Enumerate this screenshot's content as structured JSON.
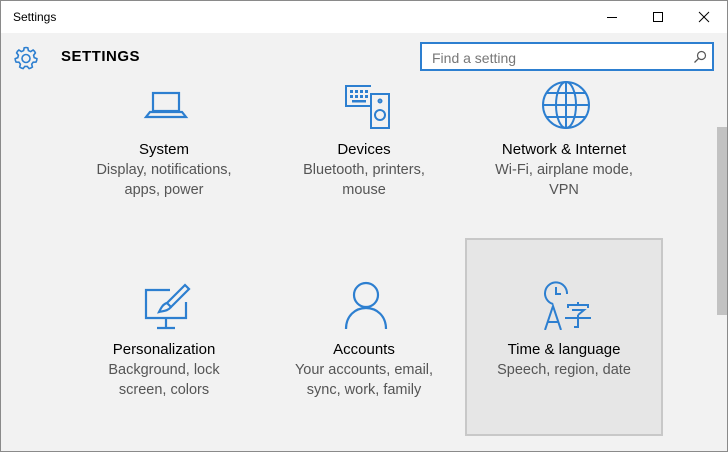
{
  "window": {
    "title": "Settings",
    "controls": {
      "minimize": "minimize",
      "maximize": "maximize",
      "close": "close"
    }
  },
  "header": {
    "title": "SETTINGS",
    "icon": "gear-icon"
  },
  "search": {
    "placeholder": "Find a setting",
    "value": "",
    "icon": "search-icon"
  },
  "accent_color": "#2d7fd0",
  "tiles": [
    {
      "label": "System",
      "desc1": "Display, notifications,",
      "desc2": "apps, power",
      "icon": "laptop-icon",
      "selected": false
    },
    {
      "label": "Devices",
      "desc1": "Bluetooth, printers,",
      "desc2": "mouse",
      "icon": "devices-icon",
      "selected": false
    },
    {
      "label": "Network & Internet",
      "desc1": "Wi-Fi, airplane mode,",
      "desc2": "VPN",
      "icon": "globe-icon",
      "selected": false
    },
    {
      "label": "Personalization",
      "desc1": "Background, lock",
      "desc2": "screen, colors",
      "icon": "personalization-icon",
      "selected": false
    },
    {
      "label": "Accounts",
      "desc1": "Your accounts, email,",
      "desc2": "sync, work, family",
      "icon": "person-icon",
      "selected": false
    },
    {
      "label": "Time & language",
      "desc1": "Speech, region, date",
      "desc2": "",
      "icon": "time-language-icon",
      "selected": true
    }
  ]
}
